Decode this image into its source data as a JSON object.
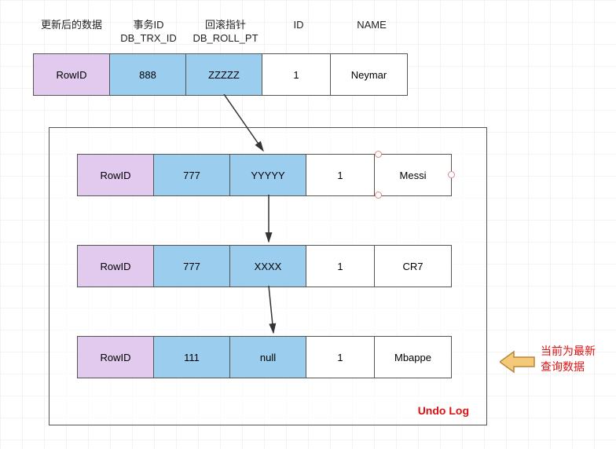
{
  "headers": {
    "updated": "更新后的数据",
    "trxid_cn": "事务ID",
    "trxid_en": "DB_TRX_ID",
    "rollpt_cn": "回滚指针",
    "rollpt_en": "DB_ROLL_PT",
    "id": "ID",
    "name": "NAME"
  },
  "rows": [
    {
      "rowid": "RowID",
      "trx": "888",
      "ptr": "ZZZZZ",
      "id": "1",
      "name": "Neymar"
    },
    {
      "rowid": "RowID",
      "trx": "777",
      "ptr": "YYYYY",
      "id": "1",
      "name": "Messi"
    },
    {
      "rowid": "RowID",
      "trx": "777",
      "ptr": "XXXX",
      "id": "1",
      "name": "CR7"
    },
    {
      "rowid": "RowID",
      "trx": "111",
      "ptr": "null",
      "id": "1",
      "name": "Mbappe"
    }
  ],
  "undo_label": "Undo Log",
  "note_line1": "当前为最新",
  "note_line2": "查询数据",
  "colors": {
    "purple": "#E1CAEE",
    "blue": "#9ACDEE",
    "red": "#d11"
  }
}
